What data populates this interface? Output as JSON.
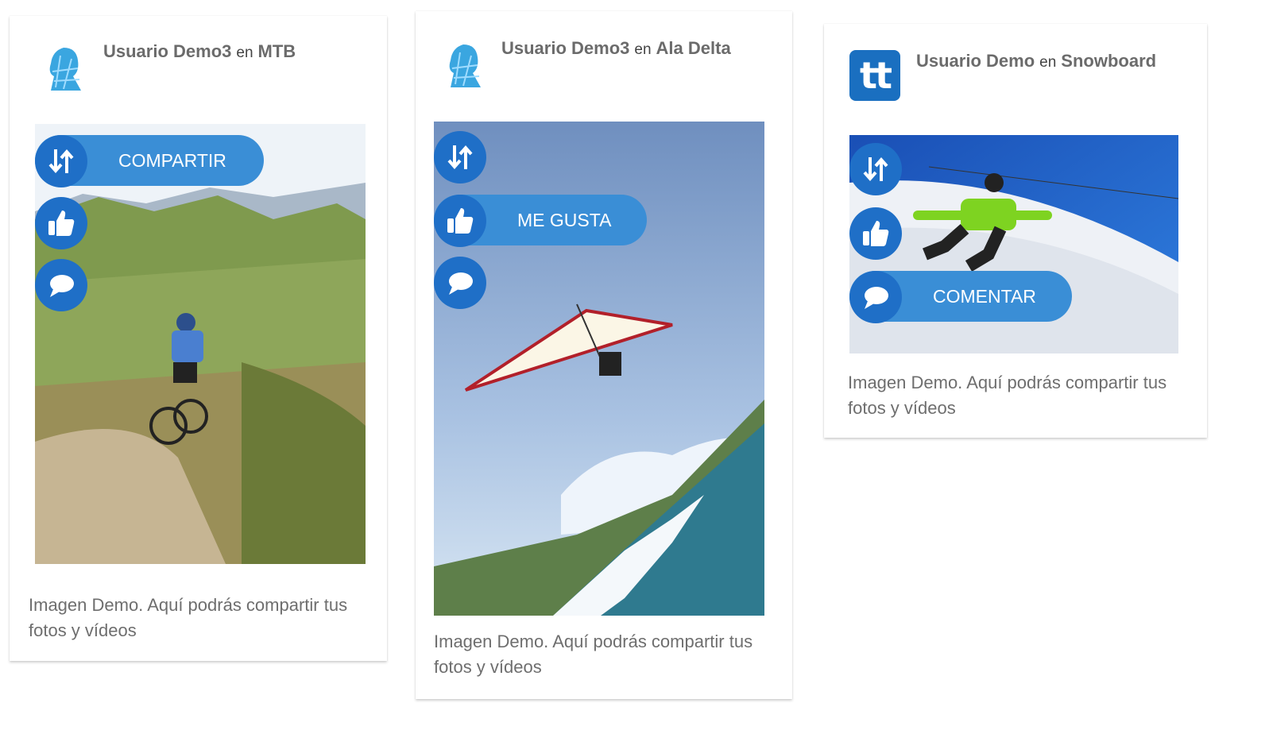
{
  "cards": [
    {
      "user": "Usuario Demo3",
      "connector": "en",
      "sport": "MTB",
      "caption": "Imagen Demo. Aquí podrás compartir tus fotos y vídeos",
      "expanded_action_label": "COMPARTIR"
    },
    {
      "user": "Usuario Demo3",
      "connector": "en",
      "sport": "Ala Delta",
      "caption": "Imagen Demo. Aquí podrás compartir tus fotos y vídeos",
      "expanded_action_label": "ME GUSTA"
    },
    {
      "user": "Usuario Demo",
      "connector": "en",
      "sport": "Snowboard",
      "caption": "Imagen Demo. Aquí podrás compartir tus fotos y vídeos",
      "expanded_action_label": "COMENTAR",
      "logo_text": "tt"
    }
  ],
  "icons": {
    "share": "share-arrows-icon",
    "like": "thumbs-up-icon",
    "comment": "speech-bubble-icon"
  },
  "colors": {
    "action_circle": "#1f6fc7",
    "action_pill": "#3a8ed6",
    "text_muted": "#6e6e6e",
    "logo_bg": "#1a6fc0"
  }
}
